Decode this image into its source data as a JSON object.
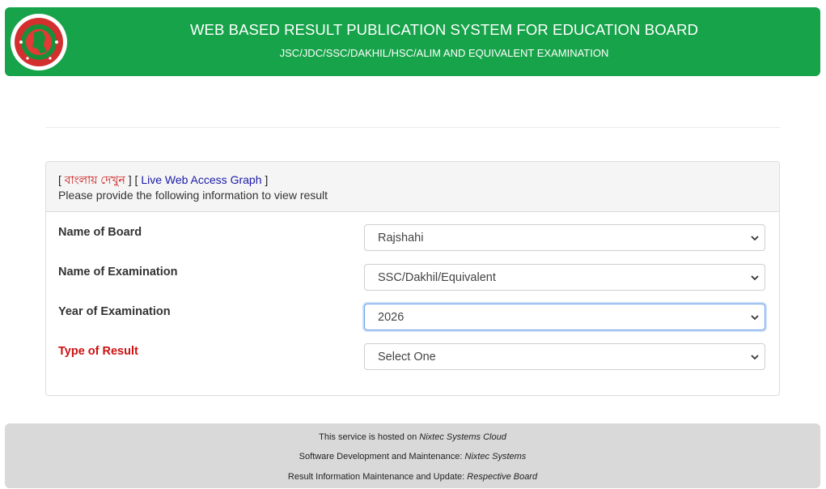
{
  "header": {
    "title": "WEB BASED RESULT PUBLICATION SYSTEM FOR EDUCATION BOARD",
    "subtitle": "JSC/JDC/SSC/DAKHIL/HSC/ALIM AND EQUIVALENT EXAMINATION",
    "brand_color": "#17a34a",
    "logo_icon": "govt-bangladesh-seal-icon"
  },
  "panel": {
    "bangla_link": "বাংলায় দেখুন",
    "graph_link": "Live Web Access Graph",
    "instructions": "Please provide the following information to view result"
  },
  "form": {
    "board": {
      "label": "Name of Board",
      "value": "Rajshahi"
    },
    "exam": {
      "label": "Name of Examination",
      "value": "SSC/Dakhil/Equivalent"
    },
    "year": {
      "label": "Year of Examination",
      "value": "2026"
    },
    "result_type": {
      "label": "Type of Result",
      "value": "Select One",
      "label_color": "#cc1111"
    }
  },
  "footer": {
    "line1_prefix": "This service is hosted on ",
    "line1_name": "Nixtec Systems Cloud",
    "line2_prefix": "Software Development and Maintenance: ",
    "line2_name": "Nixtec Systems",
    "line3_prefix": "Result Information Maintenance and Update: ",
    "line3_name": "Respective Board"
  }
}
